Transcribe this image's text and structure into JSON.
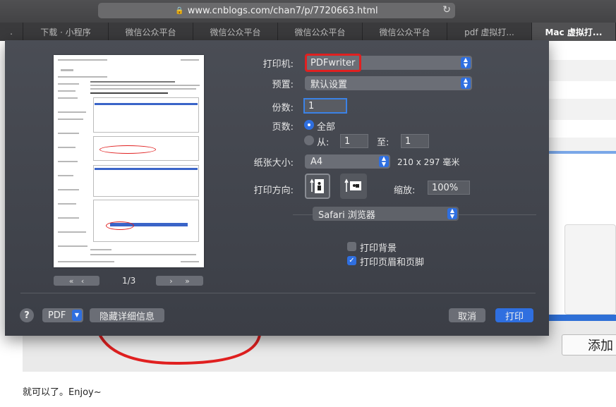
{
  "browser": {
    "url": "www.cnblogs.com/chan7/p/7720663.html",
    "tabs": [
      {
        "label": "."
      },
      {
        "label": "下载 · 小程序"
      },
      {
        "label": "微信公众平台"
      },
      {
        "label": "微信公众平台"
      },
      {
        "label": "微信公众平台"
      },
      {
        "label": "微信公众平台"
      },
      {
        "label": "pdf 虚拟打..."
      },
      {
        "label": "Mac 虚拟打..."
      }
    ]
  },
  "page": {
    "enjoy_text": "就可以了。Enjoy~",
    "add_button": "添加"
  },
  "print_dialog": {
    "printer_label": "打印机:",
    "printer_value": "PDFwriter",
    "preset_label": "预置:",
    "preset_value": "默认设置",
    "copies_label": "份数:",
    "copies_value": "1",
    "pages_label": "页数:",
    "pages_all": "全部",
    "pages_from": "从:",
    "pages_from_value": "1",
    "pages_to": "至:",
    "pages_to_value": "1",
    "paper_label": "纸张大小:",
    "paper_value": "A4",
    "paper_dims": "210 x 297 毫米",
    "orientation_label": "打印方向:",
    "scale_label": "缩放:",
    "scale_value": "100%",
    "app_section": "Safari 浏览器",
    "print_bg": "打印背景",
    "print_headers": "打印页眉和页脚",
    "print_bg_checked": false,
    "print_headers_checked": true,
    "page_counter": "1/3",
    "help": "?",
    "pdf_button": "PDF",
    "hide_details": "隐藏详细信息",
    "cancel": "取消",
    "print": "打印"
  },
  "colors": {
    "accent": "#2f6fe0",
    "highlight_red": "#e02020"
  }
}
